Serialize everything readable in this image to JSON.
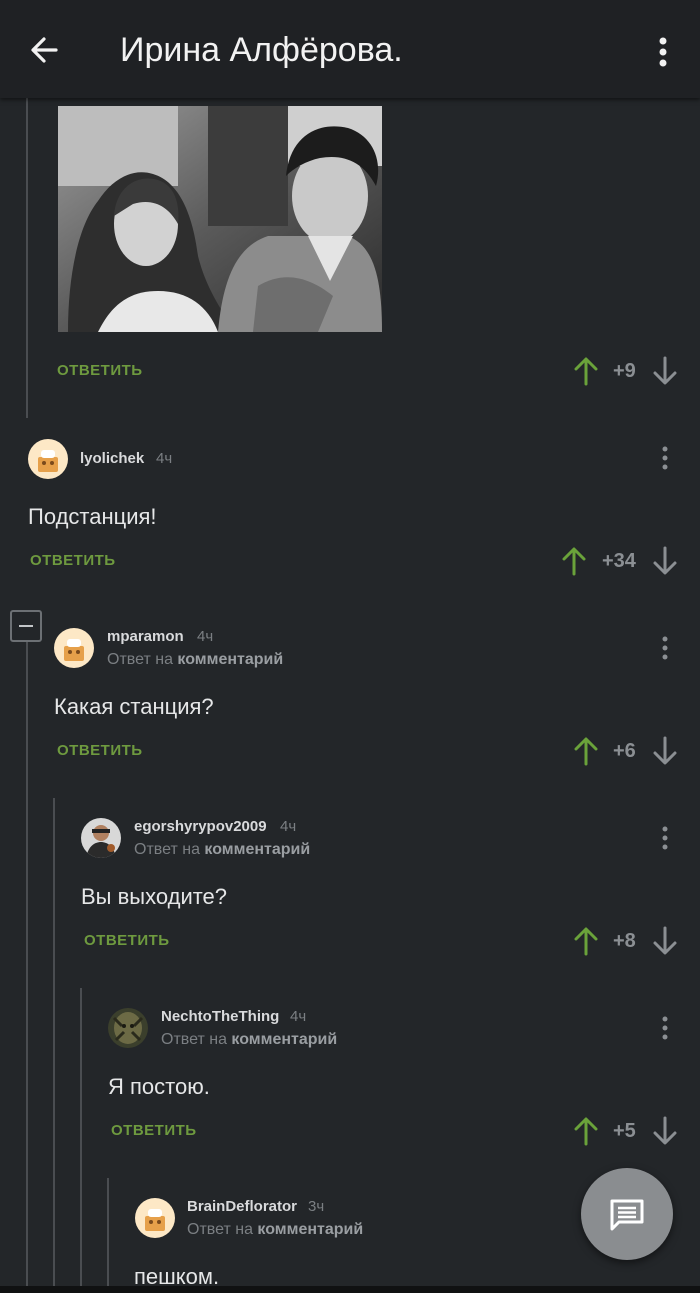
{
  "appbar": {
    "title": "Ирина Алфёрова."
  },
  "post": {
    "reply_label": "ОТВЕТИТЬ",
    "score": "+9"
  },
  "comments": [
    {
      "username": "lyolichek",
      "time": "4ч",
      "text": "Подстанция!",
      "reply_label": "ОТВЕТИТЬ",
      "score": "+34"
    },
    {
      "username": "mparamon",
      "time": "4ч",
      "reply_prefix": "Ответ на ",
      "reply_target": "комментарий",
      "text": "Какая станция?",
      "reply_label": "ОТВЕТИТЬ",
      "score": "+6"
    },
    {
      "username": "egorshyrypov2009",
      "time": "4ч",
      "reply_prefix": "Ответ на ",
      "reply_target": "комментарий",
      "text": "Вы выходите?",
      "reply_label": "ОТВЕТИТЬ",
      "score": "+8"
    },
    {
      "username": "NechtoTheThing",
      "time": "4ч",
      "reply_prefix": "Ответ на ",
      "reply_target": "комментарий",
      "text": "Я постою.",
      "reply_label": "ОТВЕТИТЬ",
      "score": "+5"
    },
    {
      "username": "BrainDeflorator",
      "time": "3ч",
      "reply_prefix": "Ответ на ",
      "reply_target": "комментарий",
      "text": "пешком."
    }
  ],
  "icons": {
    "back": "arrow-left-icon",
    "menu": "more-vertical-icon",
    "upvote": "arrow-up-icon",
    "downvote": "arrow-down-icon",
    "fab": "comment-icon"
  },
  "colors": {
    "background": "#232629",
    "appbar": "#1f2124",
    "accent_green": "#6e9a3f",
    "upvote_green": "#6aa23a",
    "muted": "#7b7f83"
  }
}
